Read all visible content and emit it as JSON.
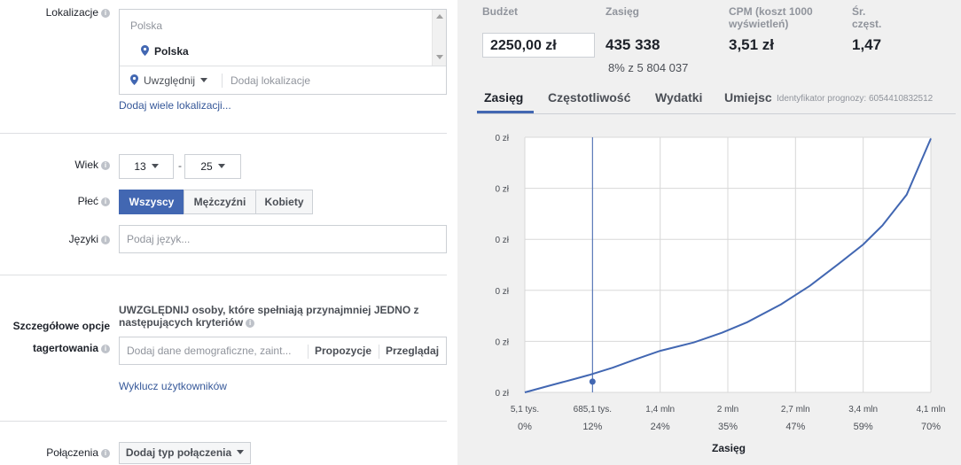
{
  "location": {
    "label": "Lokalizacje",
    "group_header": "Polska",
    "selected": "Polska",
    "include_label": "Uwzględnij",
    "add_placeholder": "Dodaj lokalizacje",
    "add_many_link": "Dodaj wiele lokalizacji..."
  },
  "age": {
    "label": "Wiek",
    "min": "13",
    "separator": "-",
    "max": "25"
  },
  "gender": {
    "label": "Płeć",
    "options": [
      "Wszyscy",
      "Mężczyźni",
      "Kobiety"
    ],
    "selected": "Wszyscy"
  },
  "languages": {
    "label": "Języki",
    "placeholder": "Podaj język..."
  },
  "detailed_targeting": {
    "label_line1": "Szczegółowe opcje",
    "label_line2": "tagertowania",
    "description_line1": "UWZGLĘDNIJ osoby, które spełniają przynajmniej JEDNO z",
    "description_line2": "następujących kryteriów",
    "input_placeholder": "Dodaj dane demograficzne, zaint...",
    "suggestions_button": "Propozycje",
    "browse_button": "Przeglądaj",
    "exclude_link": "Wyklucz użytkowników"
  },
  "connections": {
    "label": "Połączenia",
    "button": "Dodaj typ połączenia"
  },
  "stats": {
    "budget_label": "Budżet",
    "budget_value": "2250,00 zł",
    "reach_label": "Zasięg",
    "reach_value": "435 338",
    "reach_sub": "8% z 5 804 037",
    "cpm_label_line1": "CPM (koszt 1000",
    "cpm_label_line2": "wyświetleń)",
    "cpm_value": "3,51 zł",
    "freq_label_line1": "Śr.",
    "freq_label_line2": "częst.",
    "freq_value": "1,47"
  },
  "tabs": [
    "Zasięg",
    "Częstotliwość",
    "Wydatki",
    "Umiejsc"
  ],
  "active_tab": "Zasięg",
  "forecast_id": "Identyfikator prognozy: 6054410832512",
  "colors": {
    "accent": "#4267b2",
    "link": "#365899",
    "panel_bg": "#f0f0f0"
  },
  "chart_data": {
    "type": "line",
    "xlabel": "Zasięg",
    "ylabel": "",
    "y_tick_labels": [
      "0 zł",
      "0 zł",
      "0 zł",
      "0 zł",
      "0 zł",
      "0 zł"
    ],
    "x_tick_labels": [
      "5,1 tys.",
      "685,1 tys.",
      "1,4 mln",
      "2 mln",
      "2,7 mln",
      "3,4 mln",
      "4,1 mln"
    ],
    "x_tick_percent_labels": [
      "0%",
      "12%",
      "24%",
      "35%",
      "47%",
      "59%",
      "70%"
    ],
    "x_reach_values": [
      5.1,
      685.1,
      1400,
      2000,
      2700,
      3400,
      4100
    ],
    "x_range": [
      5.1,
      4100
    ],
    "y_range": [
      0,
      1
    ],
    "grid": true,
    "series": [
      {
        "x": [
          5.1,
          250,
          500,
          650,
          900,
          1150,
          1400,
          1700,
          1950,
          2200,
          2550,
          2850,
          3150,
          3400,
          3600,
          3850,
          4100
        ],
        "y": [
          0,
          0.026,
          0.052,
          0.068,
          0.097,
          0.131,
          0.163,
          0.196,
          0.234,
          0.275,
          0.345,
          0.418,
          0.505,
          0.58,
          0.655,
          0.775,
          0.995
        ]
      }
    ],
    "marker": {
      "x": 685.1,
      "y": 0.042
    }
  }
}
